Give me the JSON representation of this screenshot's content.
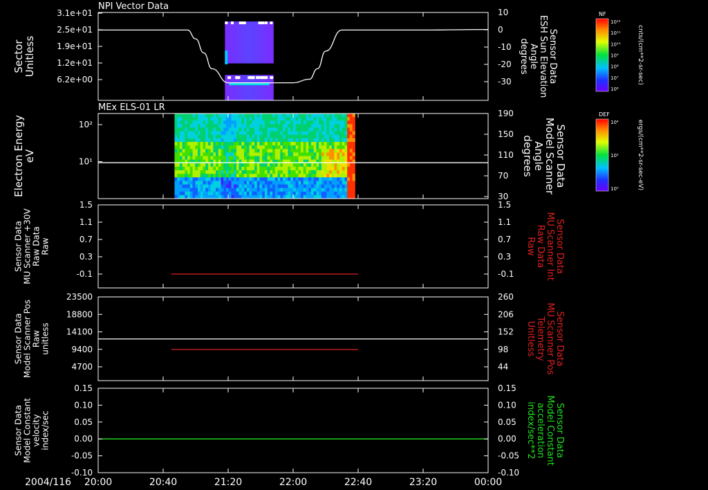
{
  "date_label": "2004/116",
  "time_ticks": [
    "20:00",
    "20:40",
    "21:20",
    "22:00",
    "22:40",
    "23:20",
    "00:00"
  ],
  "colors": {
    "background": "#000000",
    "axis": "#ffffff",
    "red_trace": "#e02020",
    "green_trace": "#20e020"
  },
  "panels": [
    {
      "title": "NPI Vector Data",
      "left_label": [
        "Sector",
        "Unitless"
      ],
      "left_ticks": [
        "3.1e+01",
        "2.5e+01",
        "1.9e+01",
        "1.2e+01",
        "6.2e+00"
      ],
      "right_label": [
        "Sensor Data",
        "ESH Sun Elevation",
        "Angle",
        "degrees"
      ],
      "right_ticks": [
        "10",
        "0",
        "-10",
        "-20",
        "-30"
      ],
      "right_label_color": "#ffffff"
    },
    {
      "title": "MEx ELS-01 LR",
      "left_label": [
        "Electron Energy",
        "eV"
      ],
      "left_ticks": [
        "10²",
        "10¹"
      ],
      "right_label": [
        "Sensor Data",
        "Model Scanner",
        "Angle",
        "degrees"
      ],
      "right_ticks": [
        "190",
        "150",
        "110",
        "70",
        "30"
      ],
      "right_label_color": "#ffffff"
    },
    {
      "title": "",
      "left_label": [
        "Sensor Data",
        "MU Scanner +30V",
        "Raw Data",
        "Raw"
      ],
      "left_ticks": [
        "1.5",
        "1.1",
        "0.7",
        "0.3",
        "-0.1"
      ],
      "right_label": [
        "Sensor Data",
        "MU Scanner Int",
        "Raw Data",
        "Raw"
      ],
      "right_ticks": [
        "1.5",
        "1.1",
        "0.7",
        "0.3",
        "-0.1"
      ],
      "right_label_color": "#e02020"
    },
    {
      "title": "",
      "left_label": [
        "Sensor Data",
        "Model Scanner Pos",
        "Raw",
        "unitless"
      ],
      "left_ticks": [
        "23500",
        "18800",
        "14100",
        "9400",
        "4700"
      ],
      "right_label": [
        "Sensor Data",
        "MU Scanner Pos",
        "Telemetry",
        "Unitless"
      ],
      "right_ticks": [
        "260",
        "206",
        "152",
        "98",
        "44"
      ],
      "right_label_color": "#e02020"
    },
    {
      "title": "",
      "left_label": [
        "Sensor Data",
        "Model Constant",
        "velocity",
        "index/sec"
      ],
      "left_ticks": [
        "0.15",
        "0.10",
        "0.05",
        "0.00",
        "-0.05",
        "-0.10"
      ],
      "right_label": [
        "Sensor Data",
        "Model Constant",
        "acceleration",
        "index/sec**2"
      ],
      "right_ticks": [
        "0.15",
        "0.10",
        "0.05",
        "0.00",
        "-0.05",
        "-0.10"
      ],
      "right_label_color": "#20e020"
    }
  ],
  "colorbars": [
    {
      "tag": "NF",
      "unit": "cnts/(cm**2-sr-sec)",
      "ticks": [
        "10¹²",
        "10¹¹",
        "10¹⁰",
        "10⁹",
        "10⁸",
        "10⁷",
        "10⁶"
      ]
    },
    {
      "tag": "DEF",
      "unit": "ergs/(cm**2-sr-sec-eV)",
      "ticks": [
        "10⁴",
        "10²",
        "10⁰"
      ]
    }
  ],
  "chart_data": [
    {
      "type": "line",
      "title": "NPI Vector Data",
      "xlabel": "",
      "ylabel": "Sector Unitless",
      "xlim": [
        "20:00",
        "00:00"
      ],
      "ylim": [
        0,
        31
      ],
      "y2label": "Sensor Data ESH Sun Elevation Angle degrees",
      "y2lim": [
        -40,
        10
      ],
      "series": [
        {
          "name": "Sensor Data ESH Sun Elevation Angle degrees",
          "axis": "right",
          "x": [
            "20:00",
            "20:55",
            "21:00",
            "21:05",
            "21:10",
            "21:20",
            "21:40",
            "22:00",
            "22:10",
            "22:15",
            "22:20",
            "22:30",
            "23:20",
            "00:00"
          ],
          "values": [
            0,
            0,
            -5,
            -13,
            -22,
            -30,
            -30,
            -30,
            -28,
            -22,
            -12,
            0,
            0,
            0.3
          ]
        }
      ],
      "spectrogram": {
        "x_start": "21:18",
        "x_end": "21:48",
        "gap_y": [
          9,
          13
        ],
        "dominant_level": "blue-violet"
      }
    },
    {
      "type": "heatmap",
      "title": "MEx ELS-01 LR",
      "ylabel": "Electron Energy eV",
      "yscale": "log",
      "ylim": [
        1,
        200
      ],
      "x_start": "20:47",
      "x_end": "22:38",
      "y2label": "Sensor Data Model Scanner Angle degrees",
      "y2lim": [
        10,
        190
      ],
      "series": [
        {
          "name": "Sensor Data Model Scanner Angle degrees",
          "axis": "right",
          "x": [
            "20:00",
            "00:00"
          ],
          "values": [
            86,
            86
          ]
        }
      ]
    },
    {
      "type": "line",
      "ylabel": "Sensor Data MU Scanner +30V Raw Data Raw",
      "ylim": [
        -0.3,
        1.5
      ],
      "y2label": "Sensor Data MU Scanner Int Raw Data Raw",
      "y2lim": [
        -0.3,
        1.5
      ],
      "series": [
        {
          "name": "Sensor Data MU Scanner Int Raw Data Raw",
          "axis": "right",
          "x": [
            "20:45",
            "22:40"
          ],
          "values": [
            0,
            0
          ]
        }
      ]
    },
    {
      "type": "line",
      "ylabel": "Sensor Data Model Scanner Pos Raw unitless",
      "ylim": [
        0,
        23500
      ],
      "y2label": "Sensor Data MU Scanner Pos Telemetry Unitless",
      "y2lim": [
        10,
        260
      ],
      "series": [
        {
          "name": "Sensor Data Model Scanner Pos Raw unitless",
          "axis": "left",
          "x": [
            "20:00",
            "00:00"
          ],
          "values": [
            11700,
            11700
          ]
        },
        {
          "name": "Sensor Data MU Scanner Pos Telemetry Unitless",
          "axis": "right",
          "x": [
            "20:45",
            "22:40"
          ],
          "values": [
            103,
            103
          ]
        }
      ]
    },
    {
      "type": "line",
      "ylabel": "Sensor Data Model Constant velocity index/sec",
      "ylim": [
        -0.1,
        0.15
      ],
      "y2label": "Sensor Data Model Constant acceleration index/sec**2",
      "y2lim": [
        -0.1,
        0.15
      ],
      "series": [
        {
          "name": "Sensor Data Model Constant acceleration index/sec**2",
          "axis": "right",
          "x": [
            "20:00",
            "00:00"
          ],
          "values": [
            0,
            0
          ]
        }
      ]
    }
  ]
}
